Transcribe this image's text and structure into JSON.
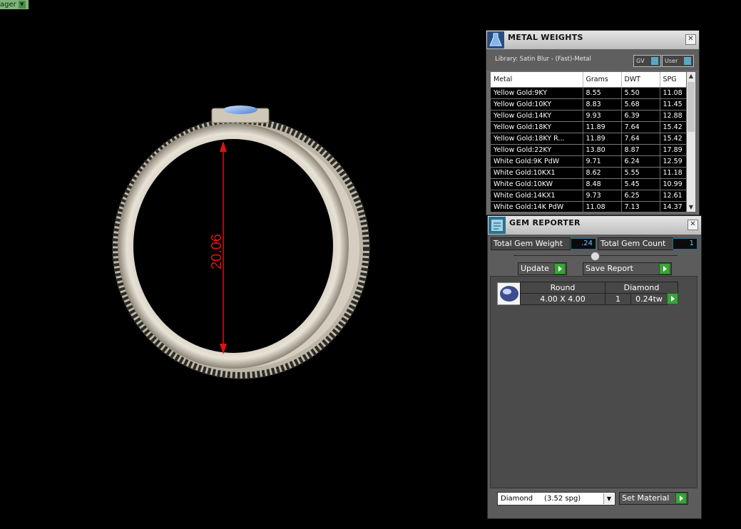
{
  "top_tag": {
    "label": "ager"
  },
  "viewport": {
    "dimension_value": "20.06"
  },
  "metal_weights": {
    "title": "METAL WEIGHTS",
    "library": "Library: Satin Blur - (Fast)-Metal",
    "toggle_gv": "GV",
    "toggle_user": "User",
    "columns": [
      "Metal",
      "Grams",
      "DWT",
      "SPG"
    ],
    "rows": [
      [
        "Yellow Gold:9KY",
        "8.55",
        "5.50",
        "11.08"
      ],
      [
        "Yellow Gold:10KY",
        "8.83",
        "5.68",
        "11.45"
      ],
      [
        "Yellow Gold:14KY",
        "9.93",
        "6.39",
        "12.88"
      ],
      [
        "Yellow Gold:18KY",
        "11.89",
        "7.64",
        "15.42"
      ],
      [
        "Yellow Gold:18KY R...",
        "11.89",
        "7.64",
        "15.42"
      ],
      [
        "Yellow Gold:22KY",
        "13.80",
        "8.87",
        "17.89"
      ],
      [
        "White Gold:9K PdW",
        "9.71",
        "6.24",
        "12.59"
      ],
      [
        "White Gold:10KX1",
        "8.62",
        "5.55",
        "11.18"
      ],
      [
        "White Gold:10KW",
        "8.48",
        "5.45",
        "10.99"
      ],
      [
        "White Gold:14KX1",
        "9.73",
        "6.25",
        "12.61"
      ],
      [
        "White Gold:14K PdW",
        "11.08",
        "7.13",
        "14.37"
      ]
    ]
  },
  "gem_reporter": {
    "title": "GEM REPORTER",
    "total_weight_label": "Total Gem Weight",
    "total_weight_value": ".24",
    "total_count_label": "Total Gem Count",
    "total_count_value": "1",
    "update_label": "Update",
    "save_label": "Save Report",
    "gem": {
      "shape": "Round",
      "size": "4.00 X 4.00",
      "material": "Diamond",
      "count": "1",
      "weight": "0.24tw"
    },
    "material_select": "Diamond     (3.52 spg)",
    "set_material_label": "Set Material"
  },
  "colors": {
    "accent_blue": "#6fc6ff",
    "green_button": "#3aa33a",
    "dimension_red": "#e01010"
  }
}
